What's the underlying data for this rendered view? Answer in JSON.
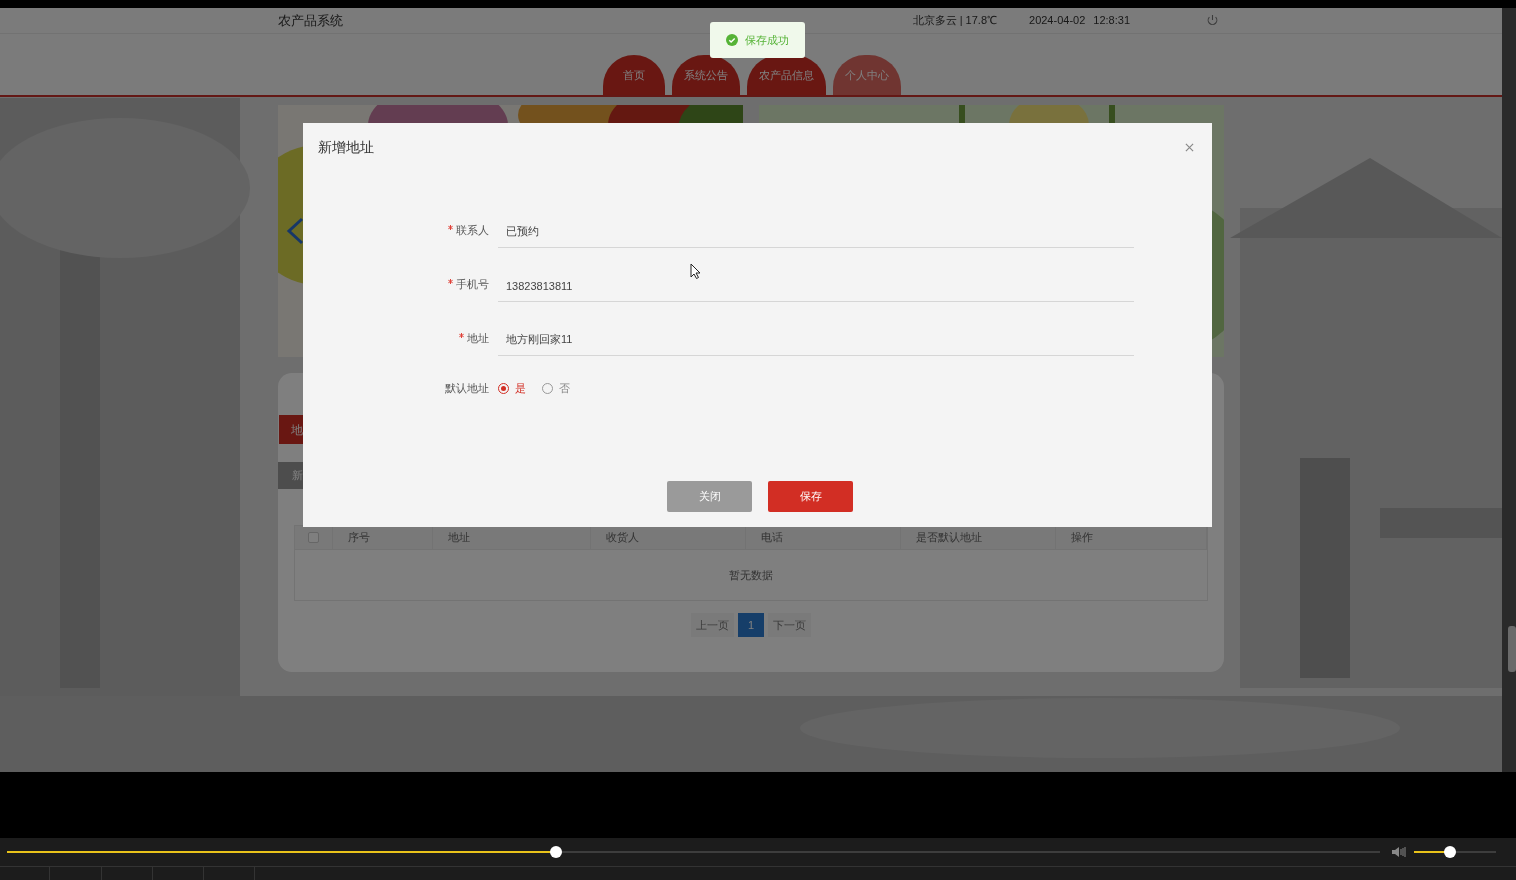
{
  "app_title": "农产品系统",
  "weather": "北京多云 | 17.8℃",
  "date": "2024-04-02",
  "time": "12:8:31",
  "toast": {
    "message": "保存成功"
  },
  "nav_tabs": [
    {
      "label": "首页",
      "selected": false
    },
    {
      "label": "系统公告",
      "selected": false
    },
    {
      "label": "农产品信息",
      "selected": false
    },
    {
      "label": "个人中心",
      "selected": true
    }
  ],
  "address_tab": {
    "label": "地"
  },
  "add_button": {
    "label": "新"
  },
  "table": {
    "select_all": {
      "checked": false
    },
    "columns": [
      "序号",
      "地址",
      "收货人",
      "电话",
      "是否默认地址",
      "操作"
    ],
    "empty_text": "暂无数据"
  },
  "pagination": {
    "prev": "上一页",
    "pages": [
      {
        "label": "1",
        "selected": true
      }
    ],
    "next": "下一页"
  },
  "dialog": {
    "title": "新增地址",
    "fields": [
      {
        "label": "联系人",
        "required": true,
        "value": "已预约"
      },
      {
        "label": "手机号",
        "required": true,
        "value": "13823813811"
      },
      {
        "label": "地址",
        "required": true,
        "value": "地方刚回家11"
      }
    ],
    "default_address": {
      "label": "默认地址",
      "options": [
        {
          "label": "是",
          "selected": true
        },
        {
          "label": "否",
          "selected": false
        }
      ]
    },
    "buttons": [
      {
        "label": "关闭",
        "kind": "secondary"
      },
      {
        "label": "保存",
        "kind": "primary"
      }
    ]
  },
  "player": {
    "progress": {
      "level": 0.4
    },
    "volume": {
      "level": 0.44
    }
  }
}
